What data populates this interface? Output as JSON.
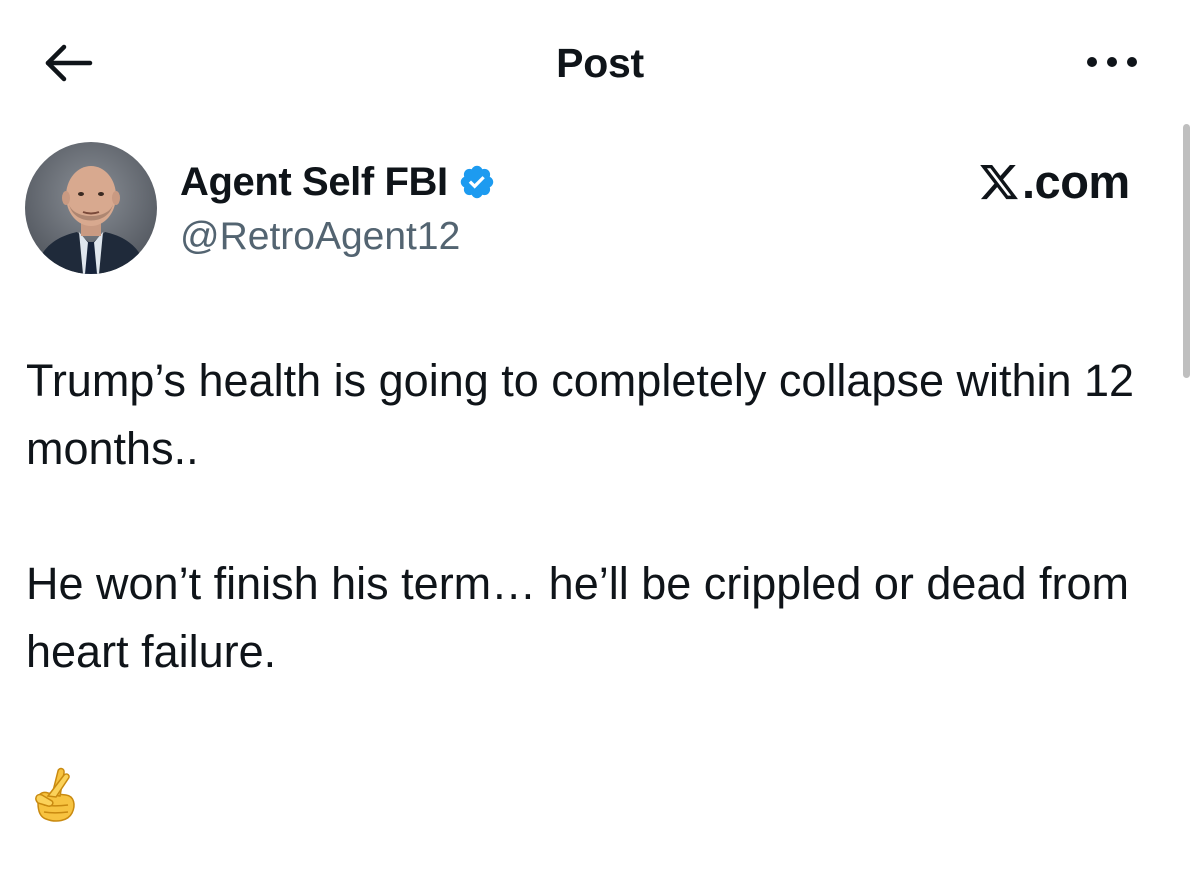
{
  "header": {
    "title": "Post",
    "back_icon": "arrow-left-icon",
    "more_icon": "ellipsis-horizontal-icon"
  },
  "author": {
    "display_name": "Agent Self FBI",
    "handle": "@RetroAgent12",
    "verified": true,
    "verified_color": "#1d9bf0"
  },
  "watermark": {
    "brand_text": ".com",
    "brand_icon": "x-logo-icon"
  },
  "post": {
    "paragraphs": [
      "Trump’s health is going to completely collapse within 12 months..",
      "He won’t finish his term… he’ll be crippled or dead from heart failure."
    ],
    "emoji": "crossed-fingers-emoji"
  },
  "colors": {
    "text_primary": "#0f1419",
    "text_secondary": "#536471",
    "background": "#ffffff"
  }
}
